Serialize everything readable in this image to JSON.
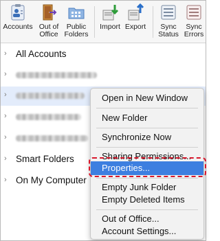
{
  "toolbar": {
    "buttons": [
      {
        "label1": "Accounts",
        "label2": ""
      },
      {
        "label1": "Out of",
        "label2": "Office"
      },
      {
        "label1": "Public",
        "label2": "Folders"
      },
      {
        "label1": "Import",
        "label2": ""
      },
      {
        "label1": "Export",
        "label2": ""
      },
      {
        "label1": "Sync",
        "label2": "Status"
      },
      {
        "label1": "Sync",
        "label2": "Errors"
      }
    ]
  },
  "folders": {
    "all_accounts": "All Accounts",
    "smart_folders": "Smart Folders",
    "on_my_computer": "On My Computer"
  },
  "context_menu": {
    "open_new_window": "Open in New Window",
    "new_folder": "New Folder",
    "synchronize_now": "Synchronize Now",
    "sharing_permissions": "Sharing Permissions...",
    "properties": "Properties...",
    "empty_junk": "Empty Junk Folder",
    "empty_deleted": "Empty Deleted Items",
    "out_of_office": "Out of Office...",
    "account_settings": "Account Settings...",
    "highlighted_item": "Properties..."
  },
  "colors": {
    "highlight": "#3d7fe0",
    "annotation": "#d8172b"
  }
}
